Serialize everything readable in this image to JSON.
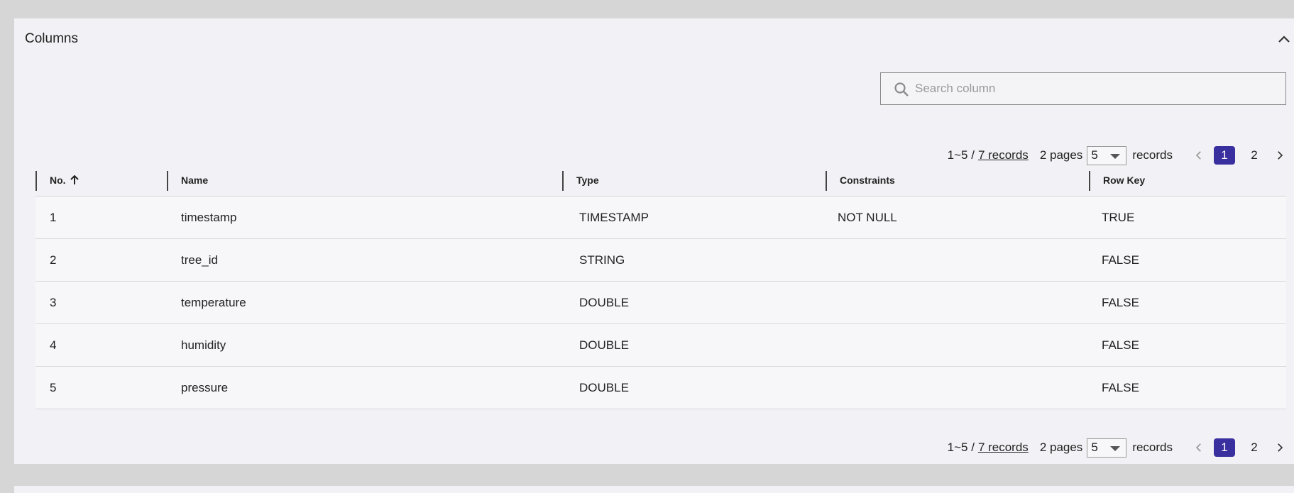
{
  "panel": {
    "title": "Columns",
    "collapse_icon": "chevron-up-icon"
  },
  "search": {
    "placeholder": "Search column",
    "value": "",
    "icon": "search-icon"
  },
  "pagination": {
    "range": "1~5 /",
    "records_link": "7 records",
    "pages_text": "2 pages",
    "page_size": "5",
    "records_label": "records",
    "pages": [
      "1",
      "2"
    ],
    "current_page": "1"
  },
  "table": {
    "headers": [
      "No.",
      "Name",
      "Type",
      "Constraints",
      "Row Key"
    ],
    "rows": [
      [
        "1",
        "timestamp",
        "TIMESTAMP",
        "NOT NULL",
        "TRUE"
      ],
      [
        "2",
        "tree_id",
        "STRING",
        "",
        "FALSE"
      ],
      [
        "3",
        "temperature",
        "DOUBLE",
        "",
        "FALSE"
      ],
      [
        "4",
        "humidity",
        "DOUBLE",
        "",
        "FALSE"
      ],
      [
        "5",
        "pressure",
        "DOUBLE",
        "",
        "FALSE"
      ]
    ]
  },
  "colors": {
    "accent": "#3a2f9e",
    "panel_bg": "#f2f1f5",
    "page_bg": "#d6d6d6"
  }
}
